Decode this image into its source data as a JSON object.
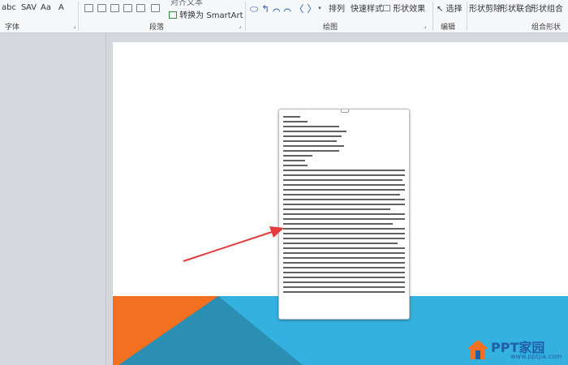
{
  "ribbon": {
    "font_group_label": "字体",
    "paragraph_group_label": "段落",
    "drawing_group_label": "绘图",
    "editing_group_label": "编辑",
    "merge_group_label": "组合形状",
    "text_direction_label": "对齐文本",
    "convert_smartart_label": "转换为 SmartArt",
    "arrange_label": "排列",
    "quick_styles_label": "快速样式",
    "shape_effects_label": "形状效果",
    "select_label": "选择",
    "shape_subtract_label": "形状剪除",
    "shape_union_label": "形状联合",
    "shape_combine_label": "形状组合",
    "shape_more_label": "形状"
  },
  "logo": {
    "name": "PPT家园",
    "site": "www.pptjia.com"
  },
  "colors": {
    "orange": "#f37021",
    "blue_light": "#35b1df",
    "blue_dark": "#2b8fb3",
    "arrow": "#e53a3a"
  }
}
